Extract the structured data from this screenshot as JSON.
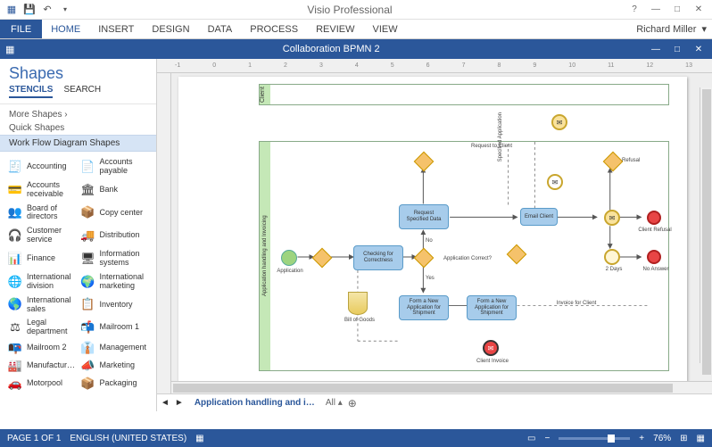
{
  "app": {
    "title": "Visio Professional",
    "user": "Richard Miller"
  },
  "qat": {
    "save": "💾",
    "undo": "↶",
    "redo": "↷"
  },
  "ribbon": {
    "file": "FILE",
    "tabs": [
      "HOME",
      "INSERT",
      "DESIGN",
      "DATA",
      "PROCESS",
      "REVIEW",
      "VIEW"
    ],
    "active": "HOME"
  },
  "doc": {
    "title": "Collaboration BPMN 2"
  },
  "shapes": {
    "title": "Shapes",
    "tabs": {
      "stencils": "STENCILS",
      "search": "SEARCH"
    },
    "more": "More Shapes",
    "chev": "›",
    "quick": "Quick Shapes",
    "stencil_header": "Work Flow Diagram Shapes",
    "items": [
      {
        "icon": "🧾",
        "label": "Accounting"
      },
      {
        "icon": "📄",
        "label": "Accounts payable"
      },
      {
        "icon": "💳",
        "label": "Accounts receivable"
      },
      {
        "icon": "🏛",
        "label": "Bank"
      },
      {
        "icon": "👥",
        "label": "Board of directors"
      },
      {
        "icon": "📦",
        "label": "Copy center"
      },
      {
        "icon": "🎧",
        "label": "Customer service"
      },
      {
        "icon": "🚚",
        "label": "Distribution"
      },
      {
        "icon": "📊",
        "label": "Finance"
      },
      {
        "icon": "🖥",
        "label": "Information systems"
      },
      {
        "icon": "🌐",
        "label": "International division"
      },
      {
        "icon": "🌍",
        "label": "International marketing"
      },
      {
        "icon": "🌎",
        "label": "International sales"
      },
      {
        "icon": "📋",
        "label": "Inventory"
      },
      {
        "icon": "⚖",
        "label": "Legal department"
      },
      {
        "icon": "📬",
        "label": "Mailroom 1"
      },
      {
        "icon": "📭",
        "label": "Mailroom 2"
      },
      {
        "icon": "👔",
        "label": "Management"
      },
      {
        "icon": "🏭",
        "label": "Manufactur…"
      },
      {
        "icon": "📣",
        "label": "Marketing"
      },
      {
        "icon": "🚗",
        "label": "Motorpool"
      },
      {
        "icon": "📦",
        "label": "Packaging"
      }
    ]
  },
  "ruler": [
    "-1",
    "0",
    "1",
    "2",
    "3",
    "4",
    "5",
    "6",
    "7",
    "8",
    "9",
    "10",
    "11",
    "12",
    "13"
  ],
  "diagram": {
    "lane1": "Client",
    "lane2": "Application handling and Invoicing",
    "start": "Application",
    "task_check": "Checking for Correctness",
    "task_request": "Request Specified Data",
    "task_email": "Email Client",
    "task_form1": "Form a New Application for Shipment",
    "task_form2": "Form a New Application for Shipment",
    "gw_label": "Application Correct?",
    "yes": "Yes",
    "no": "No",
    "request_client": "Request to Client",
    "spec_app": "Specified Application",
    "refusal": "Refusal",
    "client_refusal": "Client Refusal",
    "two_days": "2 Days",
    "no_answer": "No Answer",
    "invoice": "Invoice for Client",
    "client_invoice": "Client Invoice",
    "bill": "Bill of Goods"
  },
  "sheets": {
    "tab": "Application handling and i…",
    "all": "All",
    "add": "⊕"
  },
  "status": {
    "page": "PAGE 1 OF 1",
    "lang": "ENGLISH (UNITED STATES)",
    "zoom": "76%",
    "minus": "−",
    "plus": "+"
  }
}
